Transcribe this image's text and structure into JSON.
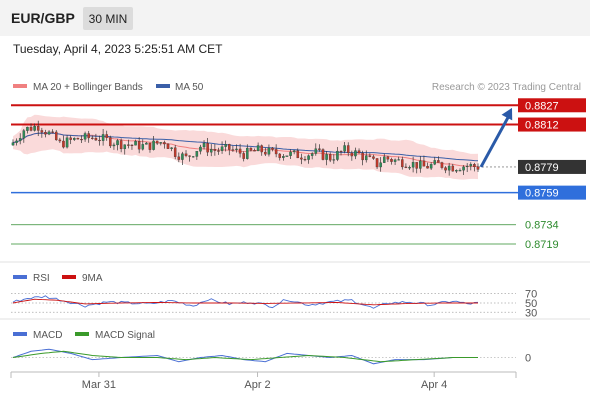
{
  "header": {
    "symbol": "EUR/GBP",
    "timeframe": "30 MIN",
    "timestamp": "Tuesday, April 4, 2023 5:25:51 AM CET",
    "attribution": "Research © 2023 Trading Central"
  },
  "colors": {
    "header_bg": "#f3f3f3",
    "badge_bg": "#dcdcdc",
    "up": "#2e8b57",
    "down": "#c0392b",
    "resistance": "#cc1111",
    "support": "#2f6fdc",
    "target_green": "#2e8b2e",
    "ma20": "#f08080",
    "ma50": "#3a5fa8",
    "bollinger": "#f9d4d4",
    "arrow": "#2a5aa8",
    "current": "#333333",
    "rsi": "#4a6fd4",
    "rsi_ma": "#cc1111",
    "macd": "#4a6fd4",
    "macd_signal": "#3a9a2a"
  },
  "chart_data": [
    {
      "type": "candlestick",
      "panel": "price",
      "legend": [
        {
          "name": "MA 20 + Bollinger Bands",
          "color": "#f08080"
        },
        {
          "name": "MA 50",
          "color": "#3a5fa8"
        }
      ],
      "ylim": [
        0.8705,
        0.8835
      ],
      "x_ticks": [
        {
          "label": "Mar 31",
          "index": 28
        },
        {
          "label": "Apr 2",
          "index": 72
        },
        {
          "label": "Apr 4",
          "index": 121
        }
      ],
      "n_candles": 130,
      "close_keyframes": [
        [
          0,
          0.8798
        ],
        [
          3,
          0.8808
        ],
        [
          7,
          0.8811
        ],
        [
          10,
          0.8805
        ],
        [
          13,
          0.8797
        ],
        [
          18,
          0.8801
        ],
        [
          23,
          0.8802
        ],
        [
          30,
          0.8797
        ],
        [
          37,
          0.8795
        ],
        [
          42,
          0.8799
        ],
        [
          45,
          0.879
        ],
        [
          48,
          0.8786
        ],
        [
          52,
          0.8795
        ],
        [
          56,
          0.8792
        ],
        [
          60,
          0.8793
        ],
        [
          64,
          0.8789
        ],
        [
          68,
          0.8792
        ],
        [
          72,
          0.879
        ],
        [
          76,
          0.8789
        ],
        [
          80,
          0.8788
        ],
        [
          84,
          0.879
        ],
        [
          88,
          0.8786
        ],
        [
          92,
          0.8792
        ],
        [
          96,
          0.8789
        ],
        [
          99,
          0.8784
        ],
        [
          101,
          0.8781
        ],
        [
          103,
          0.8786
        ],
        [
          106,
          0.8784
        ],
        [
          110,
          0.8782
        ],
        [
          114,
          0.8779
        ],
        [
          118,
          0.8781
        ],
        [
          122,
          0.8779
        ],
        [
          126,
          0.878
        ],
        [
          129,
          0.8779
        ]
      ],
      "levels": [
        {
          "value": 0.8827,
          "label": "0.8827",
          "kind": "resistance"
        },
        {
          "value": 0.8812,
          "label": "0.8812",
          "kind": "resistance"
        },
        {
          "value": 0.8779,
          "label": "0.8779",
          "kind": "current"
        },
        {
          "value": 0.8759,
          "label": "0.8759",
          "kind": "support"
        },
        {
          "value": 0.8734,
          "label": "0.8734",
          "kind": "target"
        },
        {
          "value": 0.8719,
          "label": "0.8719",
          "kind": "target"
        }
      ],
      "forecast_arrow": {
        "from_index": 129,
        "from_value": 0.8779,
        "to_value": 0.8825,
        "direction": "up"
      }
    },
    {
      "type": "line",
      "panel": "rsi",
      "legend": [
        {
          "name": "RSI",
          "color": "#4a6fd4"
        },
        {
          "name": "9MA",
          "color": "#cc1111"
        }
      ],
      "ylim": [
        22,
        80
      ],
      "levels": [
        {
          "value": 70,
          "label": "70"
        },
        {
          "value": 50,
          "label": "50"
        },
        {
          "value": 30,
          "label": "30"
        }
      ],
      "rsi_keyframes": [
        [
          0,
          52
        ],
        [
          4,
          60
        ],
        [
          9,
          64
        ],
        [
          14,
          55
        ],
        [
          20,
          44
        ],
        [
          26,
          52
        ],
        [
          32,
          50
        ],
        [
          38,
          48
        ],
        [
          44,
          55
        ],
        [
          50,
          44
        ],
        [
          54,
          58
        ],
        [
          60,
          48
        ],
        [
          66,
          52
        ],
        [
          72,
          43
        ],
        [
          76,
          58
        ],
        [
          82,
          46
        ],
        [
          88,
          52
        ],
        [
          94,
          56
        ],
        [
          100,
          38
        ],
        [
          104,
          50
        ],
        [
          110,
          52
        ],
        [
          116,
          46
        ],
        [
          122,
          54
        ],
        [
          126,
          48
        ],
        [
          129,
          50
        ]
      ],
      "ma_keyframes": [
        [
          0,
          50
        ],
        [
          6,
          58
        ],
        [
          12,
          56
        ],
        [
          20,
          48
        ],
        [
          30,
          50
        ],
        [
          40,
          51
        ],
        [
          50,
          50
        ],
        [
          60,
          50
        ],
        [
          70,
          49
        ],
        [
          80,
          50
        ],
        [
          90,
          51
        ],
        [
          100,
          46
        ],
        [
          110,
          49
        ],
        [
          120,
          50
        ],
        [
          129,
          50
        ]
      ]
    },
    {
      "type": "line",
      "panel": "macd",
      "legend": [
        {
          "name": "MACD",
          "color": "#4a6fd4"
        },
        {
          "name": "MACD Signal",
          "color": "#3a9a2a"
        }
      ],
      "ylim": [
        -0.0006,
        0.0007
      ],
      "levels": [
        {
          "value": 0,
          "label": "0"
        }
      ],
      "macd_keyframes": [
        [
          0,
          0.0
        ],
        [
          5,
          0.0003
        ],
        [
          10,
          0.0004
        ],
        [
          16,
          0.0002
        ],
        [
          22,
          -0.0001
        ],
        [
          30,
          0.0
        ],
        [
          40,
          0.0001
        ],
        [
          46,
          -0.0002
        ],
        [
          52,
          0.0
        ],
        [
          58,
          0.0001
        ],
        [
          64,
          -0.0001
        ],
        [
          70,
          -0.0002
        ],
        [
          76,
          0.0002
        ],
        [
          82,
          0.0001
        ],
        [
          88,
          0.0
        ],
        [
          94,
          0.0001
        ],
        [
          100,
          -0.0003
        ],
        [
          106,
          -0.0001
        ],
        [
          114,
          -0.0001
        ],
        [
          122,
          0.0
        ],
        [
          129,
          0.0
        ]
      ],
      "signal_keyframes": [
        [
          0,
          0.0
        ],
        [
          8,
          0.0002
        ],
        [
          14,
          0.0003
        ],
        [
          22,
          0.0001
        ],
        [
          30,
          0.0
        ],
        [
          40,
          0.0
        ],
        [
          48,
          -0.0001
        ],
        [
          56,
          0.0
        ],
        [
          66,
          -0.0001
        ],
        [
          74,
          0.0
        ],
        [
          82,
          0.0001
        ],
        [
          92,
          0.0
        ],
        [
          102,
          -0.0002
        ],
        [
          112,
          -0.0001
        ],
        [
          122,
          0.0
        ],
        [
          129,
          0.0
        ]
      ]
    }
  ]
}
